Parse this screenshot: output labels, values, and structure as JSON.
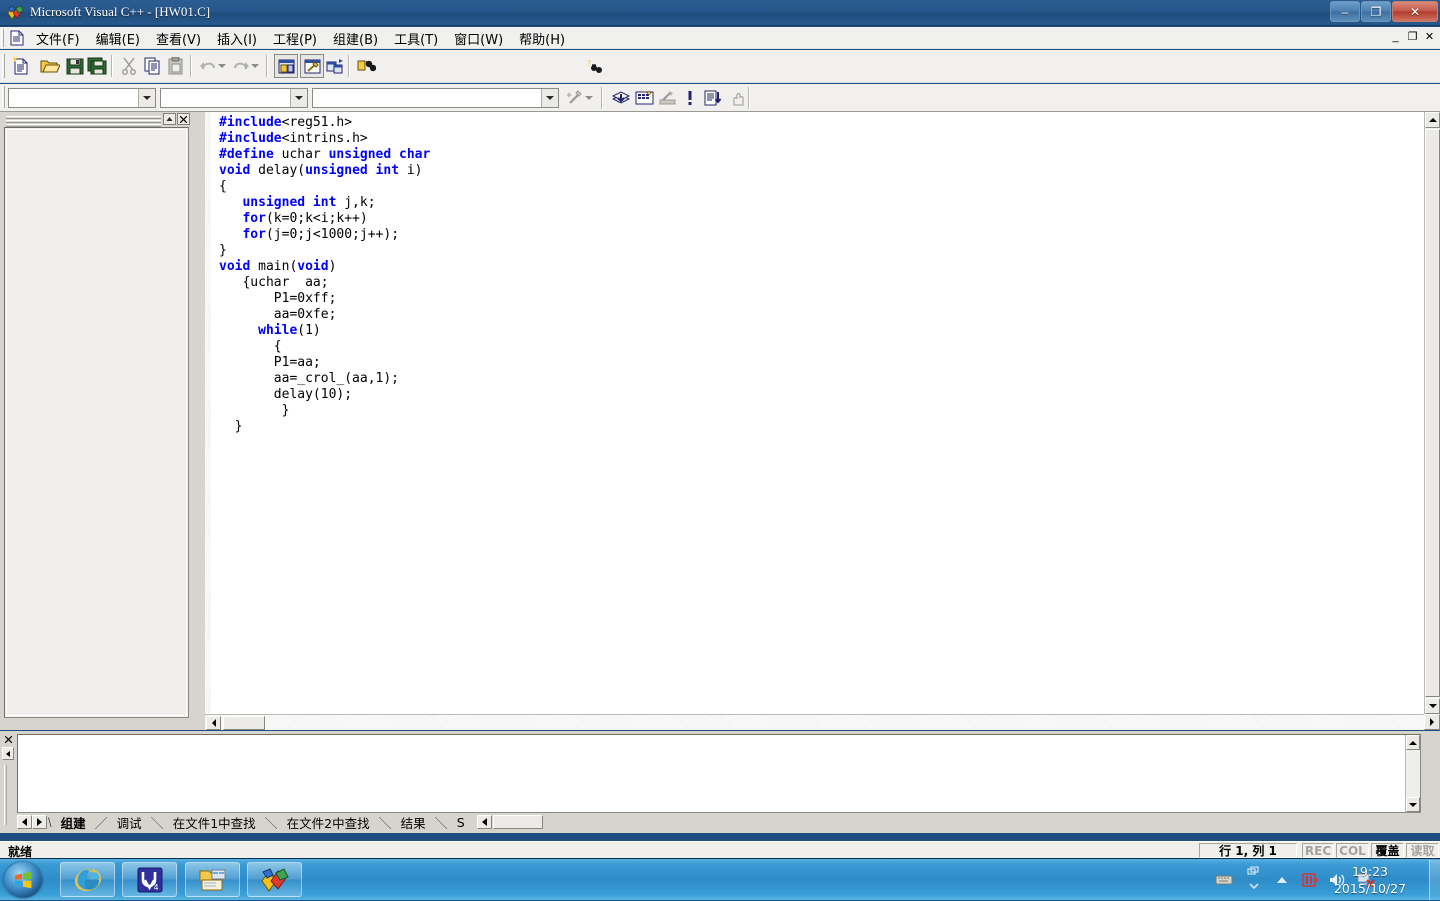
{
  "window": {
    "title": "Microsoft Visual C++ - [HW01.C]",
    "app_icon": "vcpp-logo-icon",
    "controls": {
      "minimize": "–",
      "restore": "❐",
      "close": "✕"
    },
    "mdi_controls": {
      "minimize": "_",
      "restore": "❐",
      "close": "✕"
    }
  },
  "menubar": {
    "doc_icon": "document-icon",
    "items": [
      {
        "label": "文件(F)",
        "name": "menu-file"
      },
      {
        "label": "编辑(E)",
        "name": "menu-edit"
      },
      {
        "label": "查看(V)",
        "name": "menu-view"
      },
      {
        "label": "插入(I)",
        "name": "menu-insert"
      },
      {
        "label": "工程(P)",
        "name": "menu-project"
      },
      {
        "label": "组建(B)",
        "name": "menu-build"
      },
      {
        "label": "工具(T)",
        "name": "menu-tools"
      },
      {
        "label": "窗口(W)",
        "name": "menu-window"
      },
      {
        "label": "帮助(H)",
        "name": "menu-help"
      }
    ]
  },
  "toolbar_standard": {
    "buttons": [
      {
        "name": "new-file-button",
        "icon": "new-document-icon"
      },
      {
        "name": "open-file-button",
        "icon": "open-folder-icon"
      },
      {
        "name": "save-button",
        "icon": "floppy-disk-icon"
      },
      {
        "name": "save-all-button",
        "icon": "save-all-icon"
      },
      {
        "name": "cut-button",
        "icon": "scissors-icon"
      },
      {
        "name": "copy-button",
        "icon": "copy-icon"
      },
      {
        "name": "paste-button",
        "icon": "clipboard-paste-icon"
      },
      {
        "name": "undo-button",
        "icon": "undo-arrow-icon"
      },
      {
        "name": "redo-button",
        "icon": "redo-arrow-icon"
      },
      {
        "name": "workspace-toggle-button",
        "icon": "workspace-window-icon"
      },
      {
        "name": "output-toggle-button",
        "icon": "output-window-icon"
      },
      {
        "name": "window-list-button",
        "icon": "windows-cascade-icon"
      },
      {
        "name": "find-in-files-button",
        "icon": "binoculars-icon"
      }
    ],
    "find_combo": {
      "value": "",
      "placeholder": "",
      "name": "find-combo"
    },
    "help_button": {
      "name": "context-help-button",
      "icon": "help-binoculars-icon"
    }
  },
  "toolbar_wizardbar": {
    "combo_class": {
      "value": "",
      "name": "wizardbar-class-combo"
    },
    "combo_filter": {
      "value": "",
      "name": "wizardbar-filter-combo"
    },
    "combo_member": {
      "value": "",
      "name": "wizardbar-member-combo"
    },
    "action_button": {
      "name": "wizardbar-action-button",
      "icon": "magic-wand-icon"
    },
    "build_buttons": [
      {
        "name": "compile-button",
        "icon": "compile-icon"
      },
      {
        "name": "build-button",
        "icon": "build-bricks-icon"
      },
      {
        "name": "stop-build-button",
        "icon": "stop-build-icon"
      },
      {
        "name": "execute-button",
        "icon": "exclamation-run-icon"
      },
      {
        "name": "go-button",
        "icon": "go-debug-icon"
      },
      {
        "name": "insert-breakpoint-button",
        "icon": "hand-breakpoint-icon"
      }
    ]
  },
  "workspace_pane": {
    "name": "workspace-pane",
    "collapse_label": "▲",
    "close_label": "✕",
    "content": ""
  },
  "editor": {
    "name": "source-editor-hw01-c",
    "filename": "HW01.C",
    "lines": [
      [
        {
          "t": "#include",
          "c": "pp"
        },
        {
          "t": "<reg51.h>",
          "c": "plain"
        }
      ],
      [
        {
          "t": "#include",
          "c": "pp"
        },
        {
          "t": "<intrins.h>",
          "c": "plain"
        }
      ],
      [
        {
          "t": "#define",
          "c": "pp"
        },
        {
          "t": " uchar ",
          "c": "plain"
        },
        {
          "t": "unsigned char",
          "c": "kw"
        }
      ],
      [
        {
          "t": "void",
          "c": "kw"
        },
        {
          "t": " delay(",
          "c": "plain"
        },
        {
          "t": "unsigned int",
          "c": "kw"
        },
        {
          "t": " i)",
          "c": "plain"
        }
      ],
      [
        {
          "t": "{",
          "c": "plain"
        }
      ],
      [
        {
          "t": "   ",
          "c": "plain"
        },
        {
          "t": "unsigned int",
          "c": "kw"
        },
        {
          "t": " j,k;",
          "c": "plain"
        }
      ],
      [
        {
          "t": "   ",
          "c": "plain"
        },
        {
          "t": "for",
          "c": "kw"
        },
        {
          "t": "(k=0;k<i;k++)",
          "c": "plain"
        }
      ],
      [
        {
          "t": "   ",
          "c": "plain"
        },
        {
          "t": "for",
          "c": "kw"
        },
        {
          "t": "(j=0;j<1000;j++);",
          "c": "plain"
        }
      ],
      [
        {
          "t": "}",
          "c": "plain"
        }
      ],
      [
        {
          "t": "void",
          "c": "kw"
        },
        {
          "t": " main(",
          "c": "plain"
        },
        {
          "t": "void",
          "c": "kw"
        },
        {
          "t": ")",
          "c": "plain"
        }
      ],
      [
        {
          "t": "   {uchar  aa;",
          "c": "plain"
        }
      ],
      [
        {
          "t": "       P1=0xff;",
          "c": "plain"
        }
      ],
      [
        {
          "t": "       aa=0xfe;",
          "c": "plain"
        }
      ],
      [
        {
          "t": "     ",
          "c": "plain"
        },
        {
          "t": "while",
          "c": "kw"
        },
        {
          "t": "(1)",
          "c": "plain"
        }
      ],
      [
        {
          "t": "       {",
          "c": "plain"
        }
      ],
      [
        {
          "t": "       P1=aa;",
          "c": "plain"
        }
      ],
      [
        {
          "t": "       aa=_crol_(aa,1);",
          "c": "plain"
        }
      ],
      [
        {
          "t": "       delay(10);",
          "c": "plain"
        }
      ],
      [
        {
          "t": "        }",
          "c": "plain"
        }
      ],
      [
        {
          "t": "  }",
          "c": "plain"
        }
      ]
    ],
    "scrollbars": {
      "vertical_name": "editor-vertical-scrollbar",
      "horizontal_name": "editor-horizontal-scrollbar"
    }
  },
  "output_pane": {
    "name": "output-pane",
    "close_label": "✕",
    "content": "",
    "tabs": [
      {
        "label": "组建",
        "name": "output-tab-build",
        "active": true
      },
      {
        "label": "调试",
        "name": "output-tab-debug",
        "active": false
      },
      {
        "label": "在文件1中查找",
        "name": "output-tab-find-in-files-1",
        "active": false
      },
      {
        "label": "在文件2中查找",
        "name": "output-tab-find-in-files-2",
        "active": false
      },
      {
        "label": "结果",
        "name": "output-tab-results",
        "active": false
      },
      {
        "label": "S",
        "name": "output-tab-sql-truncated",
        "active": false
      }
    ],
    "tab_separator": "\\"
  },
  "statusbar": {
    "message": "就绪",
    "position": "行 1, 列 1",
    "indicators": [
      {
        "label": "REC",
        "name": "status-rec",
        "active": false
      },
      {
        "label": "COL",
        "name": "status-col",
        "active": false
      },
      {
        "label": "覆盖",
        "name": "status-ovr",
        "active": true
      },
      {
        "label": "读取",
        "name": "status-read",
        "active": false
      }
    ]
  },
  "taskbar": {
    "start_button": {
      "name": "start-button",
      "icon": "windows-logo-icon"
    },
    "apps": [
      {
        "name": "taskbar-internet-explorer",
        "icon": "internet-explorer-icon"
      },
      {
        "name": "taskbar-keil-uvision",
        "icon": "keil-uvision4-icon"
      },
      {
        "name": "taskbar-file-explorer",
        "icon": "windows-explorer-folder-icon"
      },
      {
        "name": "taskbar-visual-cpp",
        "icon": "visual-cpp-icon"
      }
    ],
    "tray": [
      {
        "name": "tray-keyboard-icon",
        "icon": "keyboard-icon"
      },
      {
        "name": "tray-show-hidden-icon",
        "icon": "chevron-up-icon"
      },
      {
        "name": "tray-hardware-icon",
        "icon": "battery-red-icon"
      },
      {
        "name": "tray-volume-icon",
        "icon": "speaker-icon"
      },
      {
        "name": "tray-network-icon",
        "icon": "network-error-icon"
      }
    ],
    "clock": {
      "time": "19:23",
      "date": "2015/10/27"
    },
    "show_desktop": {
      "name": "show-desktop-button"
    }
  }
}
